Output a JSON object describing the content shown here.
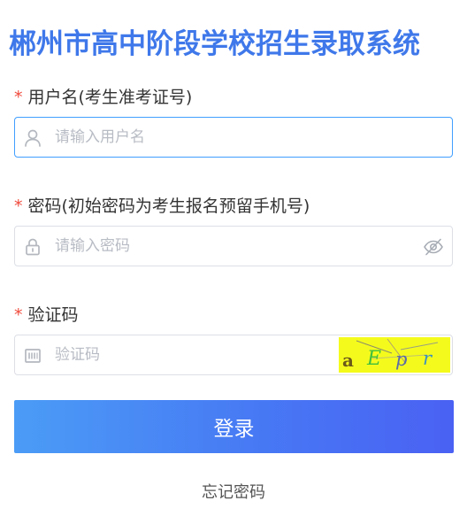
{
  "header": {
    "title": "郴州市高中阶段学校招生录取系统"
  },
  "form": {
    "required_mark": "*",
    "username": {
      "label": "用户名(考生准考证号)",
      "placeholder": "请输入用户名",
      "value": "",
      "icon": "user-icon"
    },
    "password": {
      "label": "密码(初始密码为考生报名预留手机号)",
      "placeholder": "请输入密码",
      "value": "",
      "icon": "lock-icon",
      "toggle_icon": "eye-hidden-icon"
    },
    "captcha": {
      "label": "验证码",
      "placeholder": "验证码",
      "value": "",
      "icon": "captcha-icon",
      "image_text": [
        "a",
        "E",
        "p",
        "r"
      ],
      "image_text_colors": [
        "#6b5a1a",
        "#3fbf3f",
        "#5a6aa8",
        "#3d8fbf"
      ],
      "image_bg": "#f4fb1c"
    },
    "submit_label": "登录",
    "forgot_label": "忘记密码"
  },
  "colors": {
    "title": "#3f78ea",
    "required": "#f04a3c",
    "focus_border": "#409eff",
    "button_start": "#4b9cf6",
    "button_end": "#4a61f3"
  }
}
